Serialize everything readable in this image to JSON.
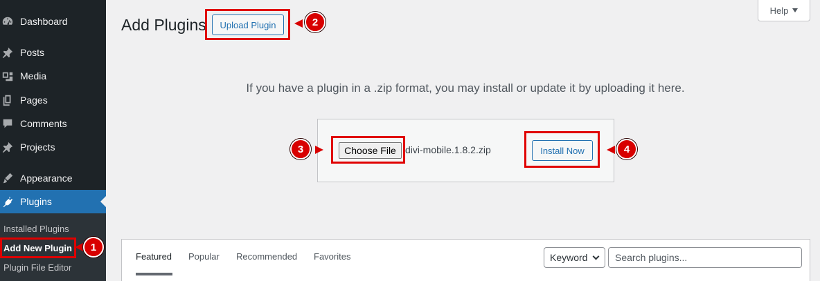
{
  "sidebar": {
    "items": [
      {
        "label": "Dashboard",
        "icon": "dashboard-icon"
      },
      {
        "label": "Posts",
        "icon": "pin-icon"
      },
      {
        "label": "Media",
        "icon": "media-icon"
      },
      {
        "label": "Pages",
        "icon": "pages-icon"
      },
      {
        "label": "Comments",
        "icon": "comment-icon"
      },
      {
        "label": "Projects",
        "icon": "pin-icon"
      },
      {
        "label": "Appearance",
        "icon": "brush-icon"
      },
      {
        "label": "Plugins",
        "icon": "plug-icon",
        "active": true
      }
    ],
    "submenu": [
      {
        "label": "Installed Plugins"
      },
      {
        "label": "Add New Plugin",
        "current": true
      },
      {
        "label": "Plugin File Editor"
      }
    ]
  },
  "header": {
    "title": "Add Plugins",
    "upload_label": "Upload Plugin",
    "help_label": "Help"
  },
  "upload": {
    "instructions": "If you have a plugin in a .zip format, you may install or update it by uploading it here.",
    "choose_file_label": "Choose File",
    "file_name": "divi-mobile.1.8.2.zip",
    "install_label": "Install Now"
  },
  "filter": {
    "tabs": [
      {
        "label": "Featured",
        "current": true
      },
      {
        "label": "Popular"
      },
      {
        "label": "Recommended"
      },
      {
        "label": "Favorites"
      }
    ],
    "search_type": "Keyword",
    "search_placeholder": "Search plugins..."
  },
  "annotations": {
    "badges": [
      "1",
      "2",
      "3",
      "4"
    ],
    "color": "#d80000"
  },
  "colors": {
    "accent": "#2271b1",
    "sidebar_bg": "#1d2327",
    "page_bg": "#f0f0f1"
  }
}
